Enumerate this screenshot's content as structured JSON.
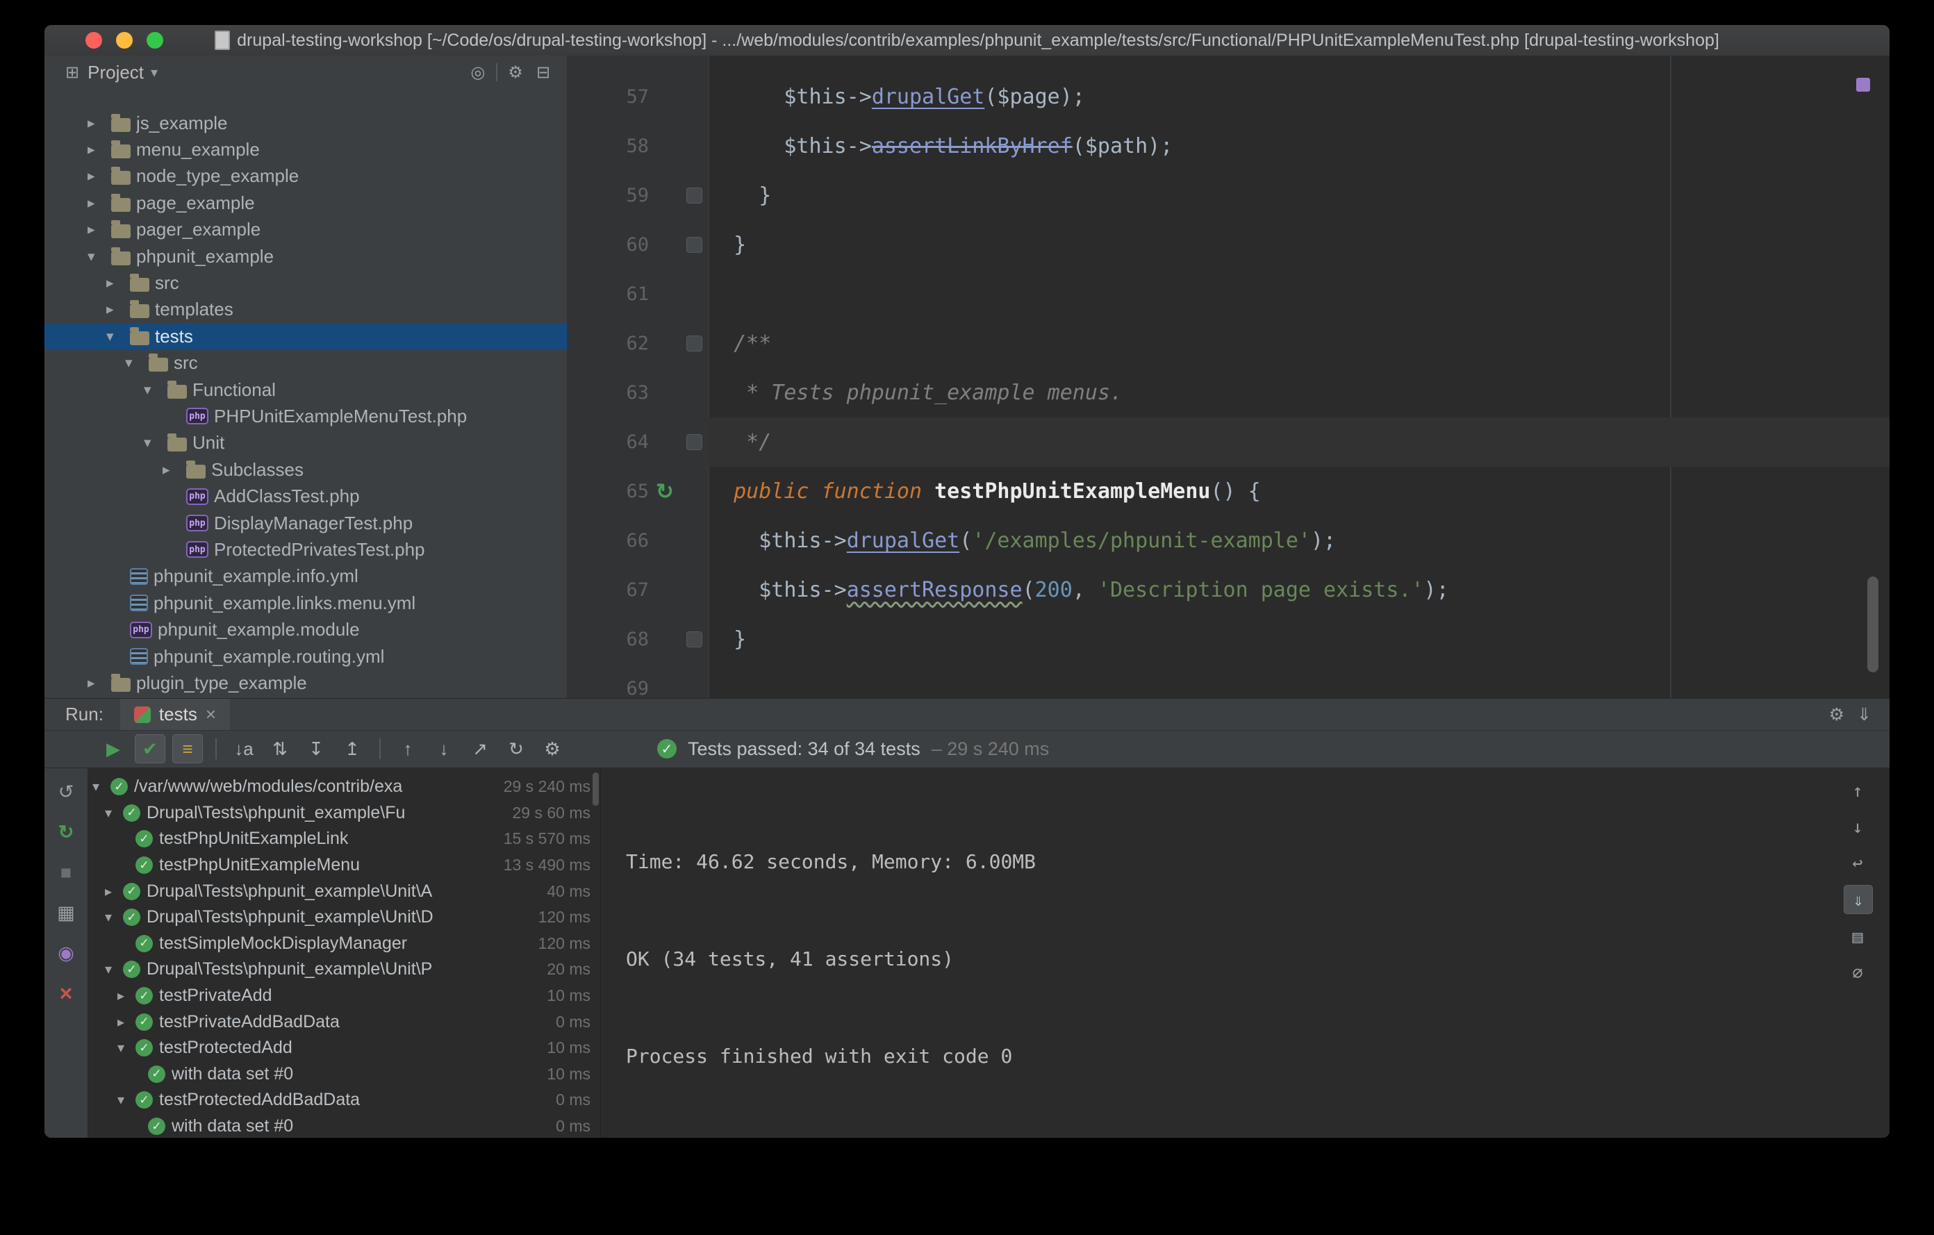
{
  "colors": {
    "selection": "#164A7D",
    "pass": "#499C54",
    "method": "#8A9BD0",
    "keyword": "#CC7832",
    "string": "#6A8759",
    "number": "#6897BB",
    "comment": "#808080"
  },
  "icons": {
    "check": "✓",
    "arrow_down": "▾",
    "arrow_right": "▸",
    "run_gutter": "↻"
  },
  "window": {
    "title": "drupal-testing-workshop [~/Code/os/drupal-testing-workshop] - .../web/modules/contrib/examples/phpunit_example/tests/src/Functional/PHPUnitExampleMenuTest.php [drupal-testing-workshop]"
  },
  "project_panel": {
    "title": "Project",
    "caret": "▾",
    "panel_icon": "⊞",
    "header_icons": [
      {
        "name": "scroll-from-source-button",
        "glyph": "◎"
      },
      {
        "name": "divider",
        "glyph": ""
      },
      {
        "name": "settings-gear-button",
        "glyph": "⚙"
      },
      {
        "name": "hide-panel-button",
        "glyph": "⊟"
      }
    ],
    "tree": [
      {
        "label": "js_example",
        "level": 1,
        "arrow": "right",
        "icon": "folder"
      },
      {
        "label": "menu_example",
        "level": 1,
        "arrow": "right",
        "icon": "folder"
      },
      {
        "label": "node_type_example",
        "level": 1,
        "arrow": "right",
        "icon": "folder"
      },
      {
        "label": "page_example",
        "level": 1,
        "arrow": "right",
        "icon": "folder"
      },
      {
        "label": "pager_example",
        "level": 1,
        "arrow": "right",
        "icon": "folder"
      },
      {
        "label": "phpunit_example",
        "level": 1,
        "arrow": "down",
        "icon": "folder"
      },
      {
        "label": "src",
        "level": 2,
        "arrow": "right",
        "icon": "folder"
      },
      {
        "label": "templates",
        "level": 2,
        "arrow": "right",
        "icon": "folder"
      },
      {
        "label": "tests",
        "level": 2,
        "arrow": "down",
        "icon": "folder",
        "selected": true
      },
      {
        "label": "src",
        "level": 3,
        "arrow": "down",
        "icon": "folder"
      },
      {
        "label": "Functional",
        "level": 4,
        "arrow": "down",
        "icon": "folder"
      },
      {
        "label": "PHPUnitExampleMenuTest.php",
        "level": 5,
        "arrow": "",
        "icon": "php"
      },
      {
        "label": "Unit",
        "level": 4,
        "arrow": "down",
        "icon": "folder"
      },
      {
        "label": "Subclasses",
        "level": 5,
        "arrow": "right",
        "icon": "folder"
      },
      {
        "label": "AddClassTest.php",
        "level": 5,
        "arrow": "",
        "icon": "php"
      },
      {
        "label": "DisplayManagerTest.php",
        "level": 5,
        "arrow": "",
        "icon": "php"
      },
      {
        "label": "ProtectedPrivatesTest.php",
        "level": 5,
        "arrow": "",
        "icon": "php"
      },
      {
        "label": "phpunit_example.info.yml",
        "level": 2,
        "arrow": "",
        "icon": "yml"
      },
      {
        "label": "phpunit_example.links.menu.yml",
        "level": 2,
        "arrow": "",
        "icon": "yml"
      },
      {
        "label": "phpunit_example.module",
        "level": 2,
        "arrow": "",
        "icon": "module"
      },
      {
        "label": "phpunit_example.routing.yml",
        "level": 2,
        "arrow": "",
        "icon": "yml"
      },
      {
        "label": "plugin_type_example",
        "level": 1,
        "arrow": "right",
        "icon": "folder"
      }
    ]
  },
  "editor": {
    "lines": [
      {
        "num": "57",
        "segments": [
          {
            "t": "      $this->",
            "c": "plain"
          },
          {
            "t": "drupalGet",
            "c": "method underline"
          },
          {
            "t": "($page);",
            "c": "plain"
          }
        ]
      },
      {
        "num": "58",
        "segments": [
          {
            "t": "      $this->",
            "c": "plain"
          },
          {
            "t": "assertLinkByHref",
            "c": "method strike"
          },
          {
            "t": "($path);",
            "c": "plain"
          }
        ]
      },
      {
        "num": "59",
        "fold": true,
        "segments": [
          {
            "t": "    }",
            "c": "plain"
          }
        ]
      },
      {
        "num": "60",
        "fold": true,
        "segments": [
          {
            "t": "  }",
            "c": "plain"
          }
        ]
      },
      {
        "num": "61",
        "segments": []
      },
      {
        "num": "62",
        "fold": true,
        "segments": [
          {
            "t": "  /**",
            "c": "comment"
          }
        ]
      },
      {
        "num": "63",
        "segments": [
          {
            "t": "   * Tests phpunit_example menus.",
            "c": "comment"
          }
        ]
      },
      {
        "num": "64",
        "fold": true,
        "caret": true,
        "segments": [
          {
            "t": "   */",
            "c": "comment"
          }
        ]
      },
      {
        "num": "65",
        "run": true,
        "segments": [
          {
            "t": "  ",
            "c": "plain"
          },
          {
            "t": "public function",
            "c": "keyword"
          },
          {
            "t": " ",
            "c": "plain"
          },
          {
            "t": "testPhpUnitExampleMenu",
            "c": "decl"
          },
          {
            "t": "() {",
            "c": "plain"
          }
        ]
      },
      {
        "num": "66",
        "segments": [
          {
            "t": "    $this->",
            "c": "plain"
          },
          {
            "t": "drupalGet",
            "c": "method underline"
          },
          {
            "t": "(",
            "c": "plain"
          },
          {
            "t": "'/examples/phpunit-example'",
            "c": "string"
          },
          {
            "t": ");",
            "c": "plain"
          }
        ]
      },
      {
        "num": "67",
        "segments": [
          {
            "t": "    $this->",
            "c": "plain"
          },
          {
            "t": "assertResponse",
            "c": "method squiggle"
          },
          {
            "t": "(",
            "c": "plain"
          },
          {
            "t": "200",
            "c": "number"
          },
          {
            "t": ", ",
            "c": "plain"
          },
          {
            "t": "'Description page exists.'",
            "c": "string"
          },
          {
            "t": ");",
            "c": "plain"
          }
        ]
      },
      {
        "num": "68",
        "fold": true,
        "segments": [
          {
            "t": "  }",
            "c": "plain"
          }
        ]
      },
      {
        "num": "69",
        "segments": []
      }
    ]
  },
  "run_panel": {
    "run_label": "Run:",
    "tab": {
      "label": "tests",
      "close": "×"
    },
    "tabbar_icons": [
      {
        "name": "settings-gear-button",
        "glyph": "⚙"
      },
      {
        "name": "hide-panel-button",
        "glyph": "⇓"
      }
    ],
    "toolbar": [
      {
        "name": "rerun-tests-button",
        "glyph": "▶",
        "cls": "green"
      },
      {
        "name": "show-passed-toggle",
        "glyph": "✔",
        "cls": "green boxed"
      },
      {
        "name": "show-ignored-toggle",
        "glyph": "≡",
        "cls": "yellow boxed"
      },
      {
        "name": "separator"
      },
      {
        "name": "sort-alphabetically-toggle",
        "glyph": "↓a"
      },
      {
        "name": "sort-by-duration-toggle",
        "glyph": "⇅"
      },
      {
        "name": "expand-all-button",
        "glyph": "↧"
      },
      {
        "name": "collapse-all-button",
        "glyph": "↥"
      },
      {
        "name": "separator"
      },
      {
        "name": "previous-failed-test-button",
        "glyph": "↑"
      },
      {
        "name": "next-failed-test-button",
        "glyph": "↓"
      },
      {
        "name": "import-test-results-button",
        "glyph": "↗"
      },
      {
        "name": "test-history-button",
        "glyph": "↻"
      },
      {
        "name": "settings-gear-button",
        "glyph": "⚙"
      }
    ],
    "status": {
      "passed": "Tests passed: 34 of 34 tests",
      "duration": "– 29 s 240 ms"
    },
    "left_toolbar": [
      {
        "name": "rerun-button",
        "glyph": "↺",
        "cls": ""
      },
      {
        "name": "rerun-failed-tests-button",
        "glyph": "↻",
        "cls": "green"
      },
      {
        "name": "stop-button",
        "glyph": "■",
        "cls": "dim"
      },
      {
        "name": "restore-layout-button",
        "glyph": "▦",
        "cls": ""
      },
      {
        "name": "pin-tab-toggle",
        "glyph": "◉",
        "cls": "purple"
      },
      {
        "name": "close-button",
        "glyph": "×",
        "cls": "red"
      }
    ],
    "tree": [
      {
        "label": "/var/www/web/modules/contrib/exa",
        "level": 0,
        "arrow": "down",
        "time": "29 s 240 ms"
      },
      {
        "label": "Drupal\\Tests\\phpunit_example\\Fu",
        "level": 1,
        "arrow": "down",
        "time": "29 s 60 ms"
      },
      {
        "label": "testPhpUnitExampleLink",
        "level": 2,
        "arrow": "",
        "time": "15 s 570 ms"
      },
      {
        "label": "testPhpUnitExampleMenu",
        "level": 2,
        "arrow": "",
        "time": "13 s 490 ms"
      },
      {
        "label": "Drupal\\Tests\\phpunit_example\\Unit\\A",
        "level": 1,
        "arrow": "right",
        "time": "40 ms"
      },
      {
        "label": "Drupal\\Tests\\phpunit_example\\Unit\\D",
        "level": 1,
        "arrow": "down",
        "time": "120 ms"
      },
      {
        "label": "testSimpleMockDisplayManager",
        "level": 2,
        "arrow": "",
        "time": "120 ms"
      },
      {
        "label": "Drupal\\Tests\\phpunit_example\\Unit\\P",
        "level": 1,
        "arrow": "down",
        "time": "20 ms"
      },
      {
        "label": "testPrivateAdd",
        "level": 2,
        "arrow": "right",
        "time": "10 ms"
      },
      {
        "label": "testPrivateAddBadData",
        "level": 2,
        "arrow": "right",
        "time": "0 ms"
      },
      {
        "label": "testProtectedAdd",
        "level": 2,
        "arrow": "down",
        "time": "10 ms"
      },
      {
        "label": "with data set #0",
        "level": 3,
        "arrow": "",
        "time": "10 ms"
      },
      {
        "label": "testProtectedAddBadData",
        "level": 2,
        "arrow": "down",
        "time": "0 ms"
      },
      {
        "label": "with data set #0",
        "level": 3,
        "arrow": "",
        "time": "0 ms"
      }
    ],
    "console": {
      "lines": [
        "Time: 46.62 seconds, Memory: 6.00MB",
        "OK (34 tests, 41 assertions)",
        "Process finished with exit code 0"
      ],
      "right_toolbar": [
        {
          "name": "up-stack-trace-button",
          "glyph": "↑",
          "cls": ""
        },
        {
          "name": "down-stack-trace-button",
          "glyph": "↓",
          "cls": ""
        },
        {
          "name": "soft-wrap-toggle",
          "glyph": "↩",
          "cls": ""
        },
        {
          "name": "scroll-to-end-toggle",
          "glyph": "⇓",
          "cls": "boxed"
        },
        {
          "name": "print-button",
          "glyph": "▤",
          "cls": ""
        },
        {
          "name": "clear-all-button",
          "glyph": "∅",
          "cls": ""
        }
      ]
    }
  }
}
